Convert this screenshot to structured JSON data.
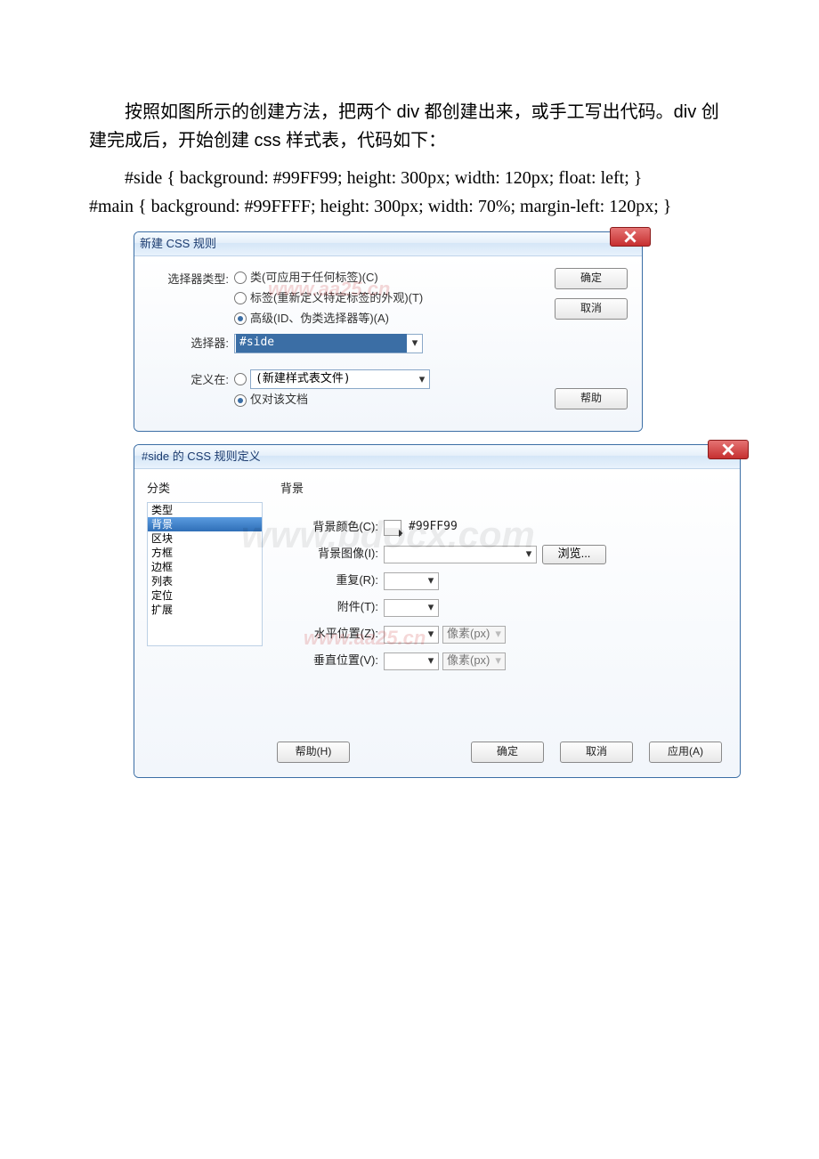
{
  "text": {
    "para1": "按照如图所示的创建方法，把两个 div 都创建出来，或手工写出代码。div 创建完成后，开始创建 css 样式表，代码如下：",
    "code1": "#side { background: #99FF99; height: 300px; width: 120px; float: left; }",
    "code2": "#main { background: #99FFFF; height: 300px; width: 70%; margin-left: 120px; }"
  },
  "dialog1": {
    "title": "新建 CSS 规则",
    "selector_type_label": "选择器类型:",
    "opt_class": "类(可应用于任何标签)(C)",
    "opt_tag": "标签(重新定义特定标签的外观)(T)",
    "opt_adv": "高级(ID、伪类选择器等)(A)",
    "selector_label": "选择器:",
    "selector_value": "#side",
    "define_label": "定义在:",
    "define_new": "(新建样式表文件)",
    "define_doc": "仅对该文档",
    "ok": "确定",
    "cancel": "取消",
    "help": "帮助"
  },
  "dialog2": {
    "title": "#side 的 CSS 规则定义",
    "cat_label": "分类",
    "categories": [
      "类型",
      "背景",
      "区块",
      "方框",
      "边框",
      "列表",
      "定位",
      "扩展"
    ],
    "panel_title": "背景",
    "bg_color_label": "背景颜色(C):",
    "bg_color_value": "#99FF99",
    "bg_image_label": "背景图像(I):",
    "browse": "浏览...",
    "repeat_label": "重复(R):",
    "attach_label": "附件(T):",
    "hpos_label": "水平位置(Z):",
    "vpos_label": "垂直位置(V):",
    "unit": "像素(px)",
    "help": "帮助(H)",
    "ok": "确定",
    "cancel": "取消",
    "apply": "应用(A)"
  },
  "watermarks": {
    "wm1": "www.aa25.cn",
    "wm2": "www.bdocx.com",
    "wm3": "www.aa25.cn"
  }
}
